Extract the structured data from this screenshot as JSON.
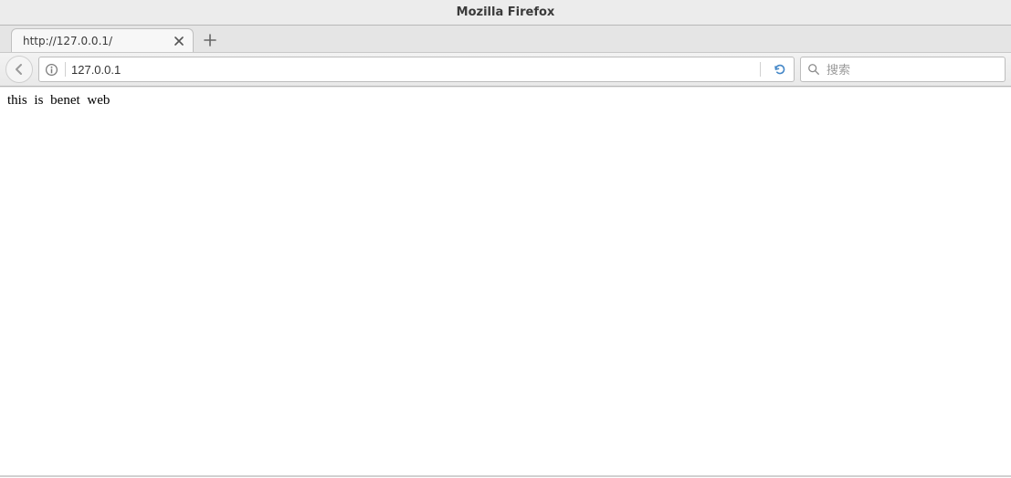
{
  "window": {
    "title": "Mozilla Firefox"
  },
  "tabs": [
    {
      "title": "http://127.0.0.1/"
    }
  ],
  "urlbar": {
    "value": "127.0.0.1"
  },
  "searchbar": {
    "placeholder": "搜索"
  },
  "page": {
    "body_text": "this is benet web"
  }
}
